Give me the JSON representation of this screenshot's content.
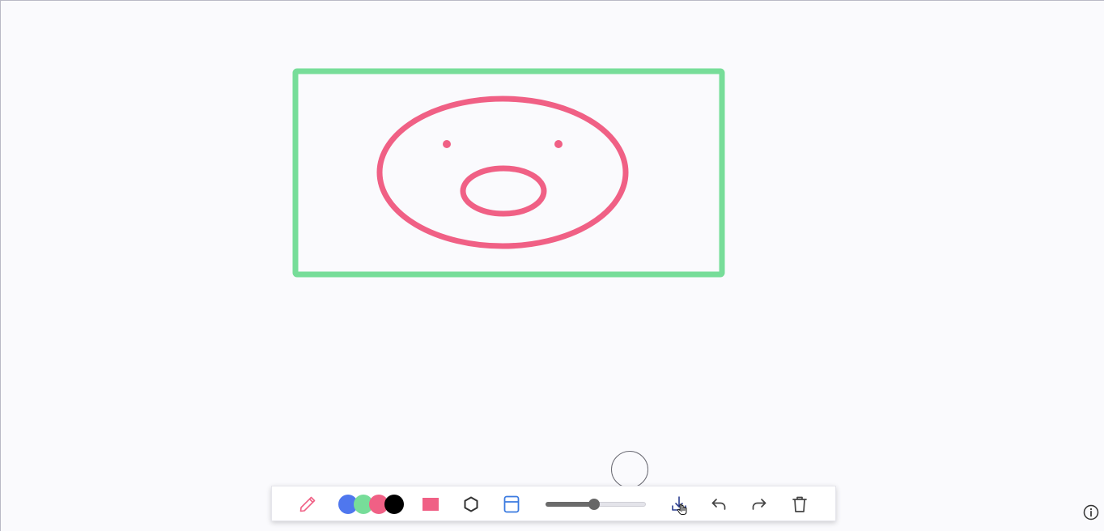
{
  "canvas": {
    "frame_color": "#77dd99",
    "face_color": "#f06085"
  },
  "toolbar": {
    "tools": [
      "pencil-icon",
      "fill-square-icon",
      "hexagon-icon",
      "frame-icon",
      "download-icon",
      "undo-icon",
      "redo-icon",
      "trash-icon"
    ],
    "swatches": [
      {
        "name": "blue",
        "color": "#4f77ee"
      },
      {
        "name": "green",
        "color": "#77dd99"
      },
      {
        "name": "pink",
        "color": "#f06085"
      },
      {
        "name": "black",
        "color": "#000000"
      }
    ],
    "selected_color": "#f06085",
    "pencil_color": "#f06085",
    "frame_icon_color": "#3a7ae0",
    "brush_size_fraction": 0.48
  },
  "info_icon": "info-icon"
}
